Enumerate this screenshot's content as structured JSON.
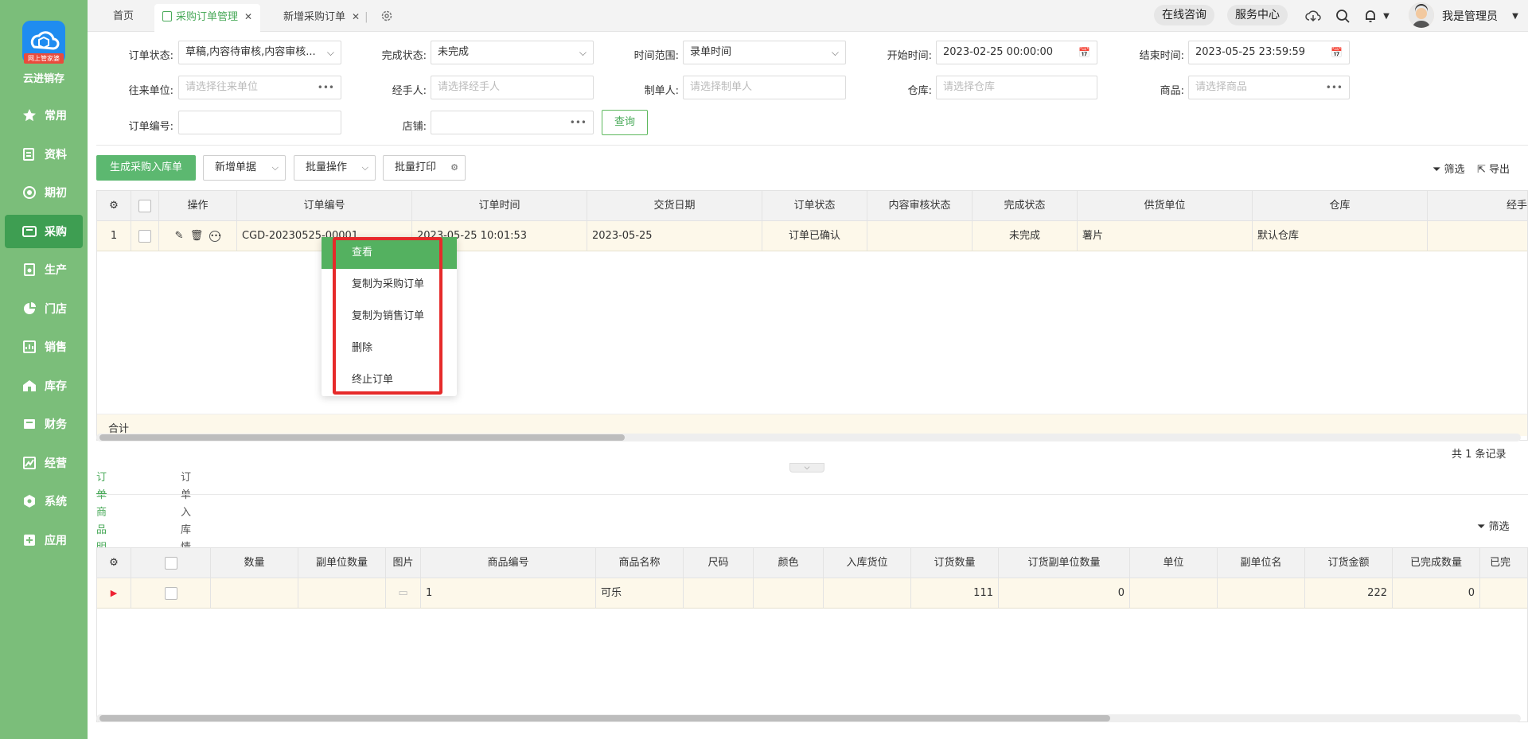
{
  "app": {
    "name": "云进销存",
    "logo_sub": "网上管家婆"
  },
  "sidebar": {
    "items": [
      {
        "label": "常用",
        "icon": "star-icon"
      },
      {
        "label": "资料",
        "icon": "document-icon"
      },
      {
        "label": "期初",
        "icon": "target-icon"
      },
      {
        "label": "采购",
        "icon": "cart-icon"
      },
      {
        "label": "生产",
        "icon": "production-icon"
      },
      {
        "label": "门店",
        "icon": "pie-icon"
      },
      {
        "label": "销售",
        "icon": "chart-icon"
      },
      {
        "label": "库存",
        "icon": "house-icon"
      },
      {
        "label": "财务",
        "icon": "wallet-icon"
      },
      {
        "label": "经营",
        "icon": "trend-icon"
      },
      {
        "label": "系统",
        "icon": "gear-icon"
      },
      {
        "label": "应用",
        "icon": "plus-square-icon"
      }
    ],
    "active_index": 3
  },
  "tabs": [
    {
      "label": "首页"
    },
    {
      "label": "采购订单管理"
    },
    {
      "label": "新增采购订单"
    }
  ],
  "topbar": {
    "online_consult": "在线咨询",
    "service_center": "服务中心",
    "user_name": "我是管理员"
  },
  "filters": {
    "order_status_label": "订单状态:",
    "order_status_value": "草稿,内容待审核,内容审核...",
    "complete_status_label": "完成状态:",
    "complete_status_value": "未完成",
    "time_range_label": "时间范围:",
    "time_range_value": "录单时间",
    "start_time_label": "开始时间:",
    "start_time_value": "2023-02-25 00:00:00",
    "end_time_label": "结束时间:",
    "end_time_value": "2023-05-25 23:59:59",
    "partner_label": "往来单位:",
    "partner_placeholder": "请选择往来单位",
    "handler_label": "经手人:",
    "handler_placeholder": "请选择经手人",
    "creator_label": "制单人:",
    "creator_placeholder": "请选择制单人",
    "warehouse_label": "仓库:",
    "warehouse_placeholder": "请选择仓库",
    "product_label": "商品:",
    "product_placeholder": "请选择商品",
    "order_no_label": "订单编号:",
    "shop_label": "店铺:",
    "query_button": "查询"
  },
  "toolbar": {
    "generate_button": "生成采购入库单",
    "new_doc": "新增单据",
    "batch_ops": "批量操作",
    "batch_print": "批量打印",
    "filter": "筛选",
    "export": "导出"
  },
  "order_table": {
    "columns": [
      "操作",
      "订单编号",
      "订单时间",
      "交货日期",
      "订单状态",
      "内容审核状态",
      "完成状态",
      "供货单位",
      "仓库",
      "经手"
    ],
    "rows": [
      {
        "index": "1",
        "order_no": "CGD-20230525-00001",
        "order_time": "2023-05-25 10:01:53",
        "delivery_date": "2023-05-25",
        "status": "订单已确认",
        "audit_status": "",
        "complete_status": "未完成",
        "supplier": "薯片",
        "warehouse": "默认仓库"
      }
    ],
    "total_label": "合计",
    "record_count": "共 1 条记录"
  },
  "context_menu": {
    "items": [
      "查看",
      "复制为采购订单",
      "复制为销售订单",
      "删除",
      "终止订单"
    ]
  },
  "sub_tabs": [
    "订单商品明细",
    "订单入库情况"
  ],
  "detail_table": {
    "filter": "筛选",
    "columns": [
      "数量",
      "副单位数量",
      "图片",
      "商品编号",
      "商品名称",
      "尺码",
      "颜色",
      "入库货位",
      "订货数量",
      "订货副单位数量",
      "单位",
      "副单位名",
      "订货金额",
      "已完成数量",
      "已完"
    ],
    "rows": [
      {
        "product_code": "1",
        "product_name": "可乐",
        "order_qty": "111",
        "order_sub_qty": "0",
        "order_amount": "222",
        "completed_qty": "0"
      }
    ]
  }
}
